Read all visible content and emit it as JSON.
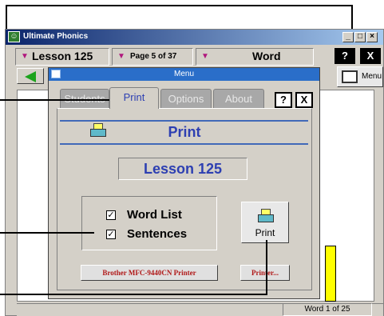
{
  "window": {
    "title": "Ultimate Phonics",
    "controls": [
      "_",
      "□",
      "×"
    ]
  },
  "toolbar": {
    "lesson_value": "Lesson 125",
    "page_value": "Page 5  of 37",
    "mode_value": "Word",
    "help_label": "?",
    "close_label": "X",
    "menu_label": "Menu"
  },
  "status": {
    "word_position": "Word  1 of 25"
  },
  "dialog": {
    "title": "Menu",
    "tabs": [
      {
        "label": "Students",
        "active": false
      },
      {
        "label": "Print",
        "active": true
      },
      {
        "label": "Options",
        "active": false
      },
      {
        "label": "About",
        "active": false
      }
    ],
    "help_label": "?",
    "close_label": "X",
    "section_title": "Print",
    "lesson_display": "Lesson 125",
    "checkboxes": [
      {
        "label": "Word List",
        "checked": true
      },
      {
        "label": "Sentences",
        "checked": true
      }
    ],
    "print_button_label": "Print",
    "printer_name": "Brother MFC-9440CN Printer",
    "printer_button_label": "Printer..."
  },
  "colors": {
    "titlebar": "#0a246a",
    "dialog_titlebar": "#2a6ec9",
    "accent_blue": "#2d3fb2",
    "printer_text_red": "#b01818",
    "back_arrow_green": "#1ca31c",
    "dropdown_arrow": "#b0177d"
  },
  "icons": [
    "app-icon",
    "back-arrow-icon",
    "menu-folder-icon",
    "printer-icon",
    "checkbox-icon"
  ]
}
